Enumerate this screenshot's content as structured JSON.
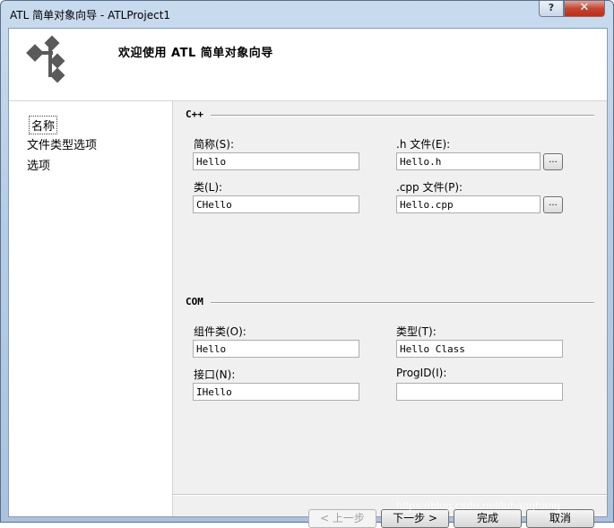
{
  "window": {
    "title": "ATL 简单对象向导 - ATLProject1",
    "help_glyph": "?",
    "close_glyph": "✕"
  },
  "header": {
    "title": "欢迎使用 ATL 简单对象向导",
    "icon": "wizard-flow-icon"
  },
  "nav": {
    "items": [
      {
        "label": "名称",
        "selected": true
      },
      {
        "label": "文件类型选项",
        "selected": false
      },
      {
        "label": "选项",
        "selected": false
      }
    ]
  },
  "cpp_section": {
    "title": "C++",
    "short_name": {
      "label": "简称(S):",
      "value": "Hello"
    },
    "h_file": {
      "label": ".h 文件(E):",
      "value": "Hello.h"
    },
    "class": {
      "label": "类(L):",
      "value": "CHello"
    },
    "cpp_file": {
      "label": ".cpp 文件(P):",
      "value": "Hello.cpp"
    },
    "browse_label": "..."
  },
  "com_section": {
    "title": "COM",
    "coclass": {
      "label": "组件类(O):",
      "value": "Hello"
    },
    "type": {
      "label": "类型(T):",
      "value": "Hello Class"
    },
    "interface": {
      "label": "接口(N):",
      "value": "IHello"
    },
    "progid": {
      "label": "ProgID(I):",
      "value": ""
    }
  },
  "buttons": {
    "prev": "< 上一步",
    "next": "下一步 >",
    "finish": "完成",
    "cancel": "取消"
  },
  "watermark": "https://blog.csdn.net/luhanghang"
}
